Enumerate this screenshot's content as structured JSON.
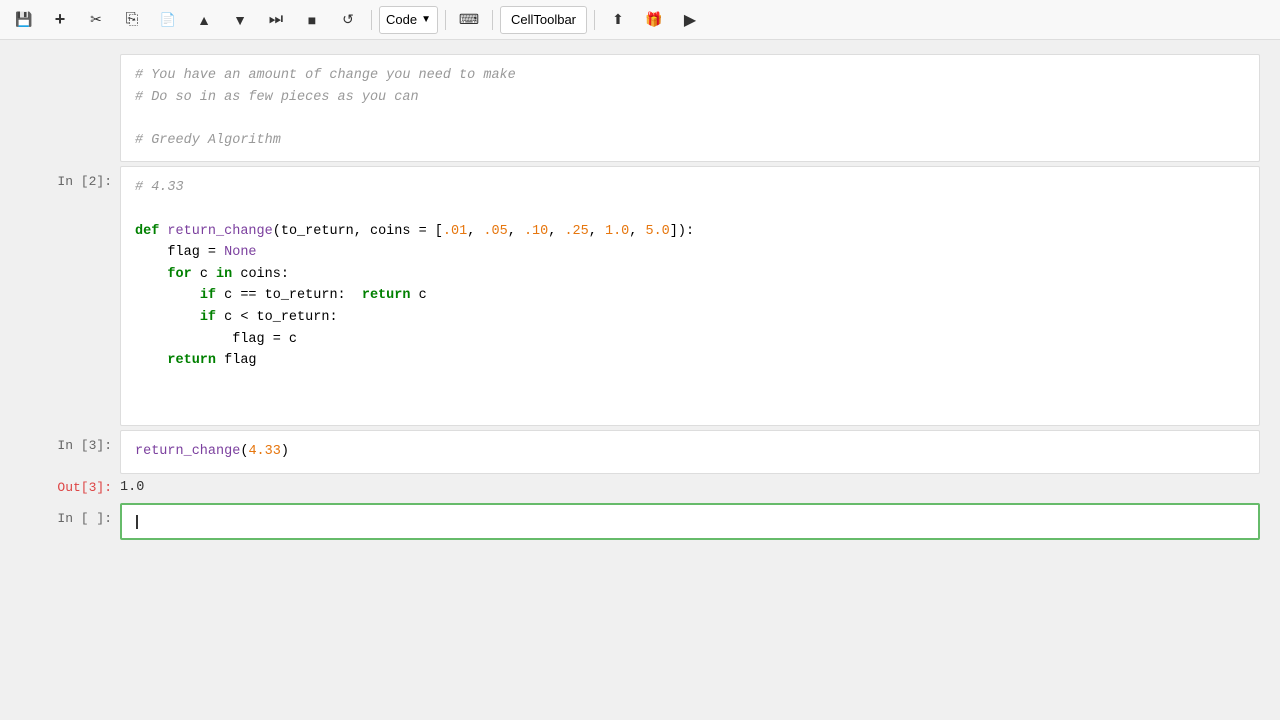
{
  "toolbar": {
    "buttons": [
      {
        "name": "save",
        "icon": "💾"
      },
      {
        "name": "add-cell",
        "icon": "+"
      },
      {
        "name": "cut",
        "icon": "✂"
      },
      {
        "name": "copy",
        "icon": "⎘"
      },
      {
        "name": "paste",
        "icon": "📋"
      },
      {
        "name": "move-up",
        "icon": "⬆"
      },
      {
        "name": "move-down",
        "icon": "⬇"
      },
      {
        "name": "fast-forward",
        "icon": "⏭"
      },
      {
        "name": "stop",
        "icon": "⏹"
      },
      {
        "name": "restart",
        "icon": "🔄"
      }
    ],
    "cell_type": "Code",
    "cell_toolbar_label": "CellToolbar",
    "btn_upload": "⬆",
    "btn_gift": "🎁",
    "btn_play": "▶"
  },
  "cells": [
    {
      "id": "cell-comment",
      "label": "",
      "type": "comment",
      "lines": [
        "# You have an amount of change you need to make",
        "# Do so in as few pieces as you can",
        "",
        "# Greedy Algorithm"
      ]
    },
    {
      "id": "cell-2",
      "label": "In [2]:",
      "type": "code",
      "lines": [
        "# 4.33",
        "",
        "def return_change(to_return, coins = [.01, .05, .10, .25, 1.0, 5.0]):",
        "    flag = None",
        "    for c in coins:",
        "        if c == to_return:  return c",
        "        if c < to_return:",
        "            flag = c",
        "    return flag"
      ]
    },
    {
      "id": "cell-3",
      "label": "In [3]:",
      "type": "code",
      "lines": [
        "return_change(4.33)"
      ]
    },
    {
      "id": "out-3",
      "label": "Out[3]:",
      "type": "output",
      "value": "1.0"
    },
    {
      "id": "cell-4",
      "label": "In [ ]:",
      "type": "active-empty"
    }
  ]
}
